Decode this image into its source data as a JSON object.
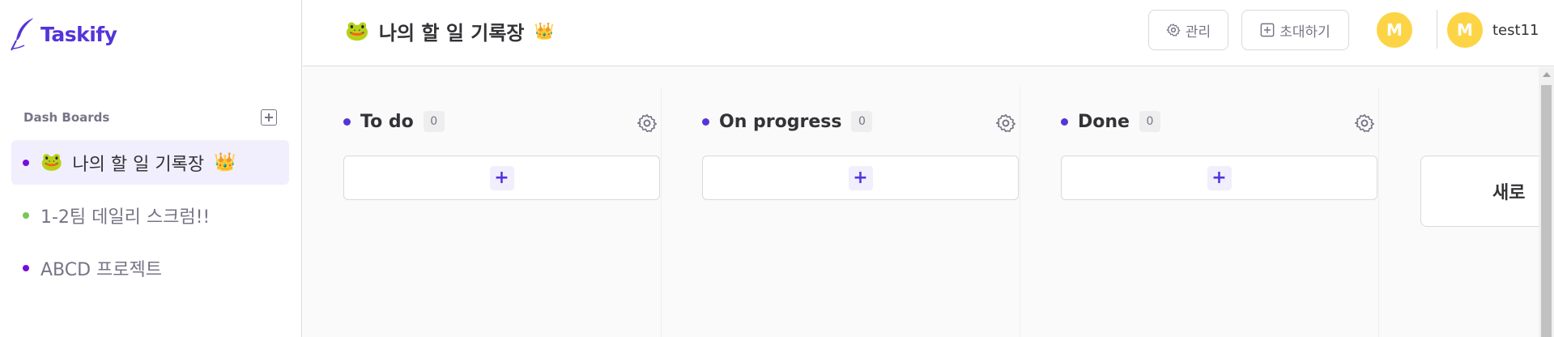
{
  "brand": {
    "name": "Taskify",
    "color": "#5534da"
  },
  "sidebar": {
    "section_title": "Dash Boards",
    "add_icon": "plus-square-icon",
    "items": [
      {
        "label": "나의 할 일 기록장",
        "emoji": "🐸",
        "dot_color": "#7ac555",
        "has_crown": true,
        "crown": "👑",
        "active": true
      },
      {
        "label": "1-2팀 데일리 스크럼!!",
        "dot_color": "#7ac555",
        "has_crown": false,
        "active": false
      },
      {
        "label": "ABCD 프로젝트",
        "dot_color": "#760dde",
        "has_crown": false,
        "active": false
      }
    ]
  },
  "header": {
    "emoji": "🐸",
    "title": "나의 할 일 기록장",
    "crown": "👑",
    "manage_label": "관리",
    "invite_label": "초대하기",
    "member_avatar": "M",
    "user_avatar": "M",
    "username": "test11"
  },
  "columns": [
    {
      "title": "To do",
      "count": "0",
      "add_label": "+"
    },
    {
      "title": "On progress",
      "count": "0",
      "add_label": "+"
    },
    {
      "title": "Done",
      "count": "0",
      "add_label": "+"
    }
  ],
  "new_column_label": "새로",
  "colors": {
    "accent": "#5534da",
    "avatar": "#fdd446",
    "active_bg": "#f1effd"
  }
}
